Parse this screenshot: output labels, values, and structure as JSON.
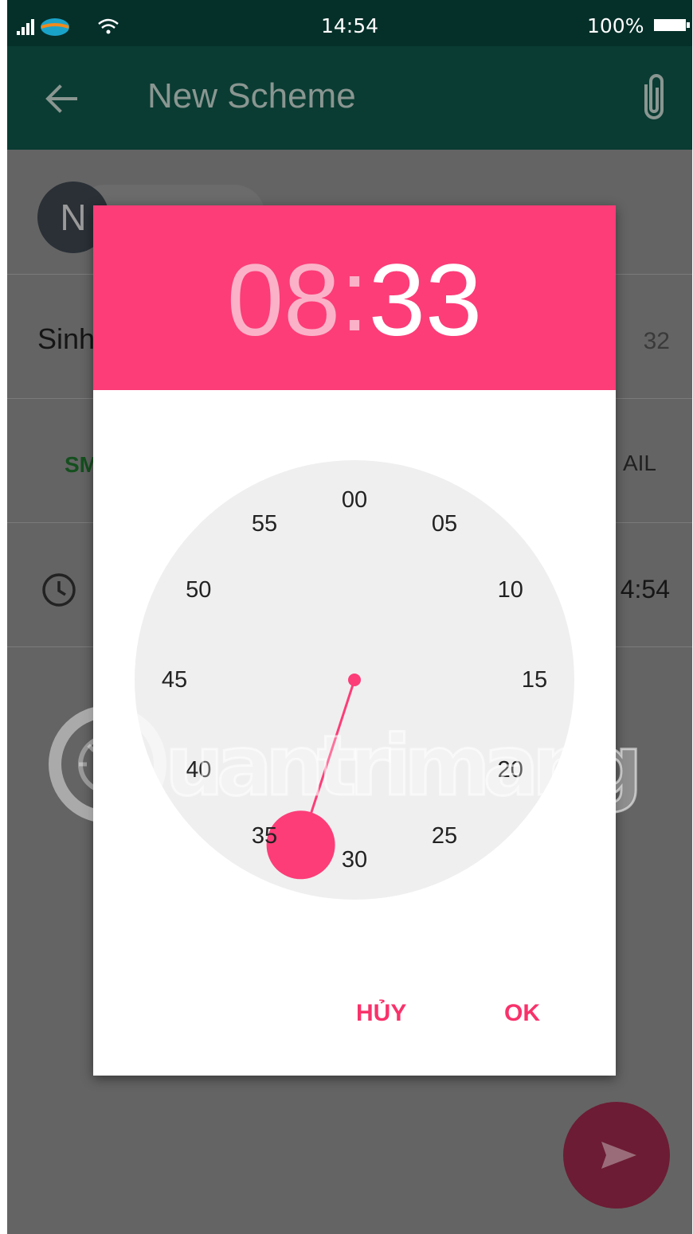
{
  "status_bar": {
    "time": "14:54",
    "battery": "100%"
  },
  "app_bar": {
    "title": "New Scheme"
  },
  "background_form": {
    "avatar_letter": "N",
    "name_partial": "Sinh",
    "count_partial": "32",
    "tab_left_partial": "SM",
    "tab_right_partial": "AIL",
    "time_partial": "4:54"
  },
  "time_picker": {
    "hours": "08",
    "separator": ":",
    "minutes": "33",
    "selected_minute": 33,
    "mode": "minutes",
    "clock_labels": [
      "00",
      "05",
      "10",
      "15",
      "20",
      "25",
      "30",
      "35",
      "40",
      "45",
      "50",
      "55"
    ],
    "cancel_label": "HỦY",
    "ok_label": "OK"
  },
  "watermark": "uantrimang",
  "colors": {
    "accent": "#fc3d78",
    "app_bar": "#0a3c33",
    "status_bar": "#05302a",
    "scrim": "#646464",
    "clock_face": "#efefef"
  }
}
